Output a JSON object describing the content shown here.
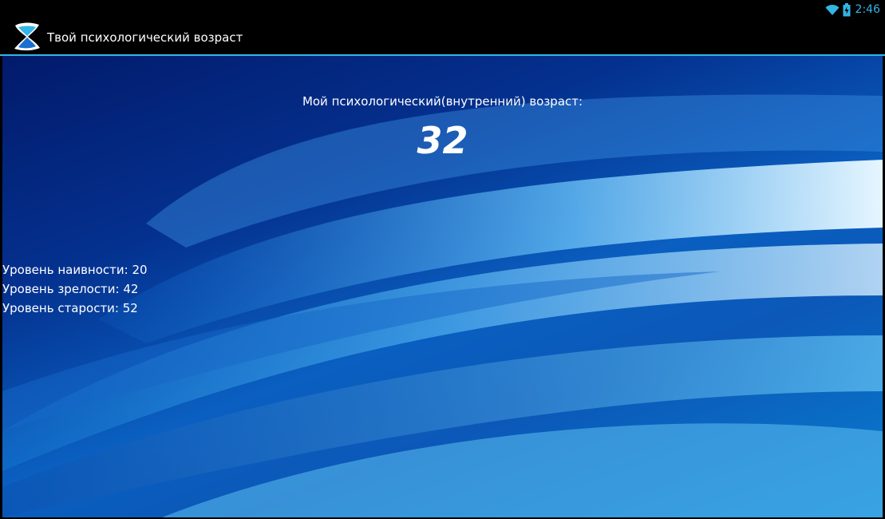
{
  "status_bar": {
    "time": "2:46",
    "icons": [
      "wifi-icon",
      "battery-icon"
    ],
    "accent": "#33b5e5"
  },
  "action_bar": {
    "title": "Твой психологический возраст",
    "icon": "hourglass-icon",
    "divider_color": "#33b5e5"
  },
  "result": {
    "caption": "Мой психологический(внутренний) возраст:",
    "age": "32"
  },
  "levels": [
    {
      "text": "Уровень наивности: 20"
    },
    {
      "text": "Уровень зрелости: 42"
    },
    {
      "text": "Уровень старости: 52"
    }
  ]
}
